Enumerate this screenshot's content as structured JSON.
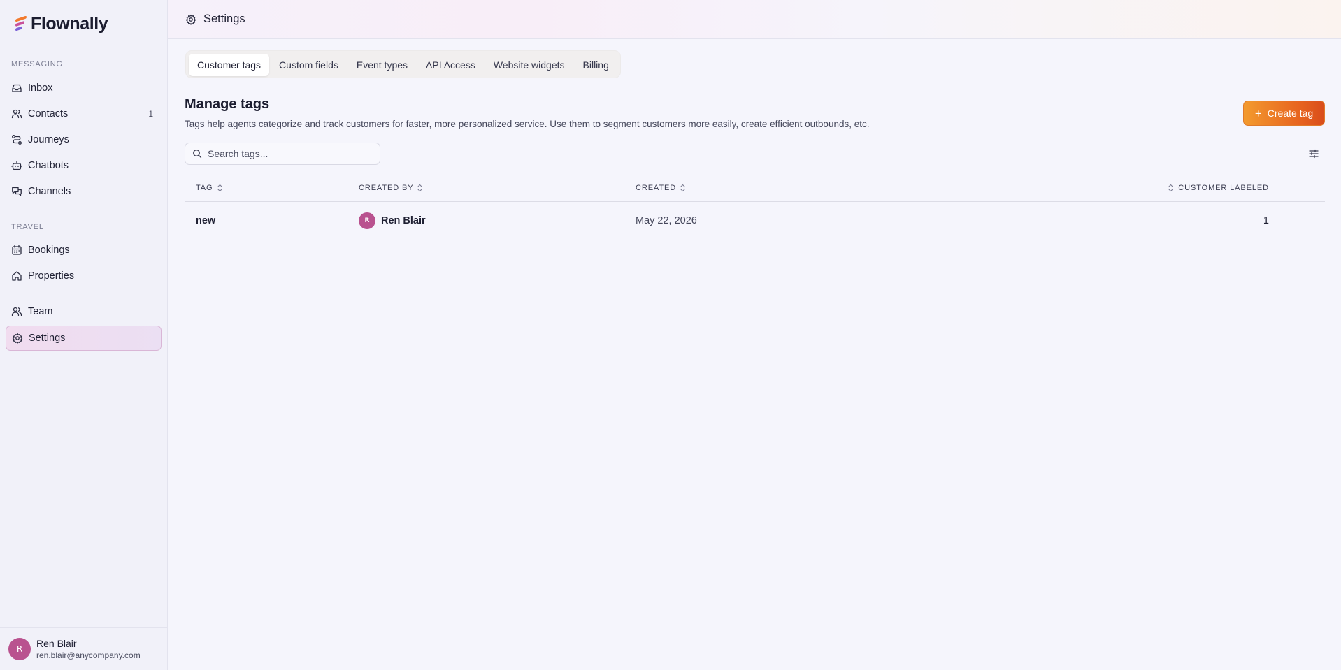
{
  "app": {
    "name": "Flownally"
  },
  "sidebar": {
    "sections": [
      {
        "label": "MESSAGING"
      },
      {
        "label": "TRAVEL"
      }
    ],
    "items": [
      {
        "label": "Inbox",
        "icon": "inbox-icon"
      },
      {
        "label": "Contacts",
        "icon": "users-icon",
        "count": "1"
      },
      {
        "label": "Journeys",
        "icon": "route-icon"
      },
      {
        "label": "Chatbots",
        "icon": "bot-icon"
      },
      {
        "label": "Channels",
        "icon": "chat-icon"
      },
      {
        "label": "Bookings",
        "icon": "calendar-icon"
      },
      {
        "label": "Properties",
        "icon": "home-icon"
      },
      {
        "label": "Team",
        "icon": "team-icon"
      },
      {
        "label": "Settings",
        "icon": "gear-icon",
        "active": true
      }
    ],
    "user": {
      "initial": "R",
      "name": "Ren Blair",
      "email": "ren.blair@anycompany.com"
    }
  },
  "header": {
    "title": "Settings",
    "icon": "gear-icon"
  },
  "tabs": [
    {
      "label": "Customer tags",
      "active": true
    },
    {
      "label": "Custom fields"
    },
    {
      "label": "Event types"
    },
    {
      "label": "API Access"
    },
    {
      "label": "Website widgets"
    },
    {
      "label": "Billing"
    }
  ],
  "main": {
    "title": "Manage tags",
    "description": "Tags help agents categorize and track customers for faster, more personalized service. Use them to segment customers more easily, create efficient outbounds, etc.",
    "create_label": "Create tag",
    "search_placeholder": "Search tags..."
  },
  "table": {
    "columns": [
      "TAG",
      "CREATED BY",
      "CREATED",
      "CUSTOMER LABELED"
    ],
    "rows": [
      {
        "tag": "new",
        "created_by": "Ren Blair",
        "created_by_initial": "R",
        "created": "May 22, 2026",
        "customer_labeled": "1"
      }
    ]
  },
  "colors": {
    "accent_gradient_start": "#f39a2e",
    "accent_gradient_end": "#d94d1b",
    "avatar": "#b9528f",
    "active_nav": "#f1dcef"
  }
}
